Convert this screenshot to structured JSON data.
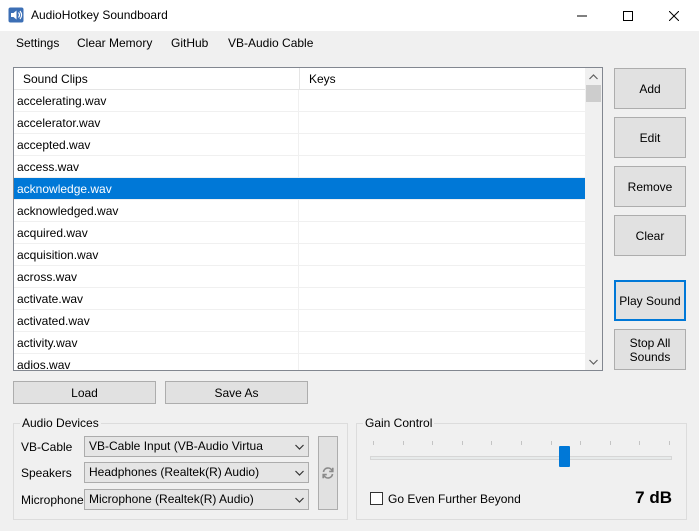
{
  "window": {
    "title": "AudioHotkey Soundboard",
    "icon": "speaker-icon",
    "controls": [
      "minimize-icon",
      "maximize-icon",
      "close-icon"
    ]
  },
  "menu": [
    "Settings",
    "Clear Memory",
    "GitHub",
    "VB-Audio Cable"
  ],
  "list": {
    "columns": [
      "Sound Clips",
      "Keys"
    ],
    "rows": [
      {
        "clip": "accelerating.wav",
        "keys": ""
      },
      {
        "clip": "accelerator.wav",
        "keys": ""
      },
      {
        "clip": "accepted.wav",
        "keys": ""
      },
      {
        "clip": "access.wav",
        "keys": ""
      },
      {
        "clip": "acknowledge.wav",
        "keys": "",
        "selected": true
      },
      {
        "clip": "acknowledged.wav",
        "keys": ""
      },
      {
        "clip": "acquired.wav",
        "keys": ""
      },
      {
        "clip": "acquisition.wav",
        "keys": ""
      },
      {
        "clip": "across.wav",
        "keys": ""
      },
      {
        "clip": "activate.wav",
        "keys": ""
      },
      {
        "clip": "activated.wav",
        "keys": ""
      },
      {
        "clip": "activity.wav",
        "keys": ""
      },
      {
        "clip": "adios.wav",
        "keys": ""
      }
    ],
    "selection_color": "#0078d7"
  },
  "side_buttons": {
    "add": "Add",
    "edit": "Edit",
    "remove": "Remove",
    "clear": "Clear",
    "play_sound": "Play Sound",
    "stop_all_line1": "Stop All",
    "stop_all_line2": "Sounds"
  },
  "bottom_buttons": {
    "load": "Load",
    "save_as": "Save As"
  },
  "audio_devices": {
    "title": "Audio Devices",
    "vb_cable_label": "VB-Cable",
    "vb_cable_value": "VB-Cable Input (VB-Audio Virtua",
    "speakers_label": "Speakers",
    "speakers_value": "Headphones (Realtek(R) Audio)",
    "microphone_label": "Microphone",
    "microphone_value": "Microphone (Realtek(R) Audio)",
    "refresh_icon": "refresh-icon"
  },
  "gain": {
    "title": "Gain Control",
    "checkbox_label": "Go Even Further Beyond",
    "checked": false,
    "value_text": "7 dB",
    "slider_fraction": 0.65,
    "accent": "#0078d7"
  }
}
